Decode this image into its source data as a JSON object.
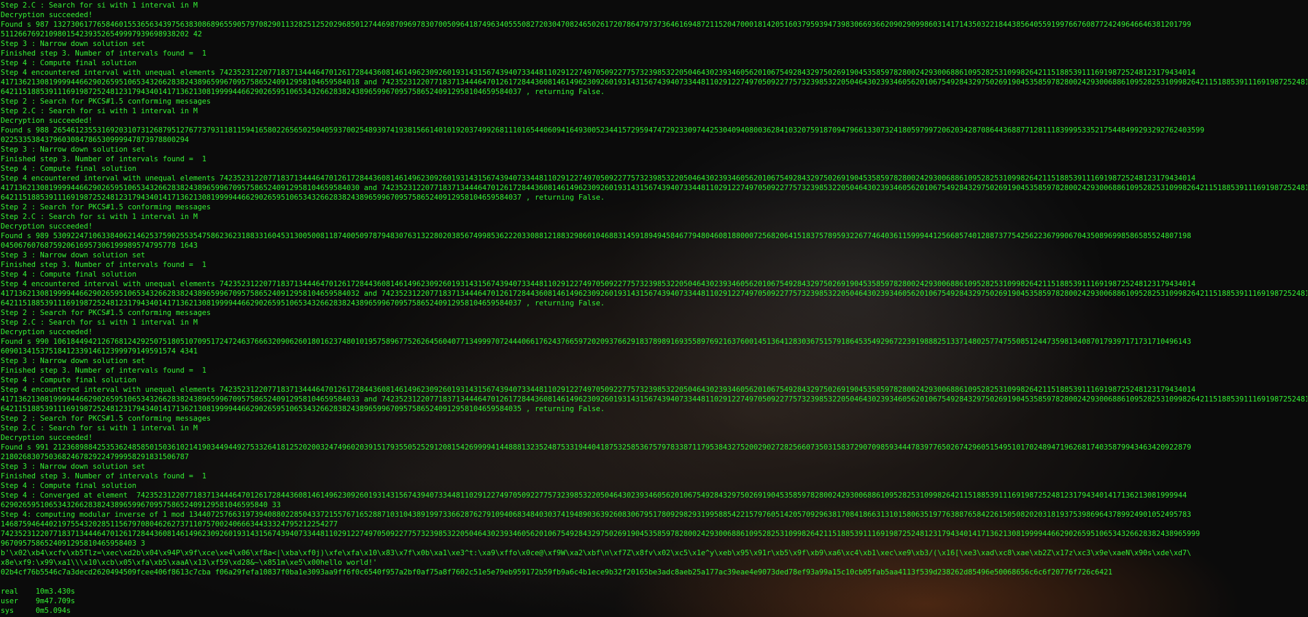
{
  "terminal": {
    "lines": [
      "Step 2.C : Search for si with 1 interval in M",
      "Decryption succeeded!",
      "Found s 987 13273061776584601553656343975638308689655905797082901132825125202968501274469870969783070050964187496340555082720304708246502617207864797373646169487211520470001814205160379593947398306693662090290998603141714350322184438564055919976676087724249646646381201799",
      "5112667692109801542393526549997939698938202 42",
      "Step 3 : Narrow down solution set",
      "Finished step 3. Number of intervals found =  1",
      "Step 4 : Compute final solution",
      "Step 4 encountered interval with unequal elements 7423523122077183713444647012617284436081461496230926019314315674394073344811029122749705092277573239853220504643023934605620106754928432975026919045358597828002429300688610952825310998264211518853911169198725248123179434014",
      "4171362130819999446629026595106534326628382438965996709575865240912958104659584018 and 7423523122077183713444647012617284436081461496230926019314315674394073344811029122749705092277573239853220504643023934605620106754928432975026919045358597828002429300688610952825310998264211518853911169198725248123179",
      "64211518853911169198725248123179434014171362130819999446629026595106534326628382438965996709575865240912958104659584037 , returning False.",
      "Step 2 : Search for PKCS#1.5 conforming messages",
      "Step 2.C : Search for si with 1 interval in M",
      "Decryption succeeded!",
      "Found s 988 26546123553169203107312687951276773793118115941658022656502504059370025489397419381566140101920374992681110165440609416493005234415729594747292330974425304094080036284103207591870947966133073241805979972062034287086443688771281118399953352175448499293292762403599",
      "0225335384379603084786530999947873978800294",
      "Step 3 : Narrow down solution set",
      "Finished step 3. Number of intervals found =  1",
      "Step 4 : Compute final solution",
      "Step 4 encountered interval with unequal elements 7423523122077183713444647012617284436081461496230926019314315674394073344811029122749705092277573239853220504643023934605620106754928432975026919045358597828002429300688610952825310998264211518853911169198725248123179434014",
      "4171362130819999446629026595106534326628382438965996709575865240912958104659584030 and 7423523122077183713444647012617284436081461496230926019314315674394073344811029122749705092277573239853220504643023934605620106754928432975026919045358597828002429300688610952825310998264211518853911169198725248123179",
      "64211518853911169198725248123179434014171362130819999446629026595106534326628382438965996709575865240912958104659584037 , returning False.",
      "Step 2 : Search for PKCS#1.5 conforming messages",
      "Step 2.C : Search for si with 1 interval in M",
      "Decryption succeeded!",
      "Found s 989 53092247106338406214625375902553547586236231883316045313005008118740050978794830763132280203856749985362220330881218832986010468831459189494584677948046081880007256820641518375789593226774640361159994412566857401288737754256223679906704350896998586585524807198",
      "0450676076875920616957306199989574795778 1643",
      "Step 3 : Narrow down solution set",
      "Finished step 3. Number of intervals found =  1",
      "Step 4 : Compute final solution",
      "Step 4 encountered interval with unequal elements 7423523122077183713444647012617284436081461496230926019314315674394073344811029122749705092277573239853220504643023934605620106754928432975026919045358597828002429300688610952825310998264211518853911169198725248123179434014",
      "4171362130819999446629026595106534326628382438965996709575865240912958104659584032 and 7423523122077183713444647012617284436081461496230926019314315674394073344811029122749705092277573239853220504643023934605620106754928432975026919045358597828002429300688610952825310998264211518853911169198725248123179",
      "64211518853911169198725248123179434014171362130819999446629026595106534326628382438965996709575865240912958104659584037 , returning False.",
      "Step 2 : Search for PKCS#1.5 conforming messages",
      "Step 2.C : Search for si with 1 interval in M",
      "Decryption succeeded!",
      "Found s 990 10618449421267681242925075180510709517247246376663209062601801623748010195758967752626456040771349997072444066176243766597202093766291837898916935589769216376001451364128303675157918645354929672239198882513371480257747550851244735981340870179397171731710496143",
      "6090134153751841233914612399979149591574 4341",
      "Step 3 : Narrow down solution set",
      "Finished step 3. Number of intervals found =  1",
      "Step 4 : Compute final solution",
      "Step 4 encountered interval with unequal elements 7423523122077183713444647012617284436081461496230926019314315674394073344811029122749705092277573239853220504643023934605620106754928432975026919045358597828002429300688610952825310998264211518853911169198725248123179434014",
      "4171362130819999446629026595106534326628382438965996709575865240912958104659584033 and 7423523122077183713444647012617284436081461496230926019314315674394073344811029122749705092277573239853220504643023934605620106754928432975026919045358597828002429300688610952825310998264211518853911169198725248123179",
      "64211518853911169198725248123179434014171362130819999446629026595106534326628382438965996709575865240912958104659584035 , returning False.",
      "Step 2 : Search for PKCS#1.5 conforming messages",
      "Step 2.C : Search for si with 1 interval in M",
      "Decryption succeeded!",
      "Found s 991 21236898842535362485850150361021419034494492753326418125202003247496020391517935505252912081542699994144888132352487533194404187532585367579783387117953843275200290272825660735031583729070985934447839776502674296051549510170248947196268174035879943463420922879",
      "2180268307503682467829224799958291831506787",
      "Step 3 : Narrow down solution set",
      "Finished step 3. Number of intervals found =  1",
      "Step 4 : Compute final solution",
      "Step 4 : Converged at element  742352312207718371344464701261728443608146149623092601931431567439407334481102912274970509227757323985322050464302393460562010675492843297502691904535859782800242930068861095282531099826421151885391116919872524812317943401417136213081999944",
      "6290265951065343266283824389659967095758652409129581046595840 33",
      "Step 4: computing modular inverse of 1 mod 1344072576631973940880228504337215576716528871031043891997336628762791094068348403037419489036392608306795178092982931995885422157976051420570929638170841866313101580635197763887658422615050820203181937539869643789924901052495783",
      "14687594644021975543202851156797080462627371107570024066634433324795212254277",
      "7423523122077183713444647012617284436081461496230926019314315674394073344811029122749705092277573239853220504643023934605620106754928432975026919045358597828002429300688610952825310998264211518853911169198725248123179434014171362130819999446629026595106534326628382438965999",
      "9670957586524091295810465958403 3",
      "b'\\x02\\xb4\\xcfv\\xb5Tlz=\\xec\\xd2b\\x04\\x94P\\x9f\\xce\\xe4\\x06\\xf8a<|\\xba\\xf0j)\\xfe\\xfa\\x10\\x83\\x7f\\x0b\\xa1\\xe3^t:\\xa9\\xffo\\x0ce@\\xf9W\\xa2\\xbf\\n\\xf7Z\\x8fv\\x02\\xc5\\x1e^y\\xeb\\x95\\x91r\\xb5\\x9f\\xb9\\xa6\\xc4\\xb1\\xec\\xe9\\xb3/(\\x16[\\xe3\\xad\\xc8\\xae\\xb2Z\\x17z\\xc3\\x9e\\xaeN\\x90s\\xde\\xd7\\",
      "x8e\\xf9:\\x99\\xa1\\\\\\x10\\xcb\\x05\\xfa\\xb5\\xaaA\\x13\\xf59\\xd28&~\\x851m\\xe5\\x00hello world!'",
      "02b4cf76b5546c7a3decd2620494509fcee406f8613c7cba f06a29fefa10837f0ba1e3093aa9ff6f0c6540f957a2bf0af75a8f7602c51e5e79eb959172b59fb9a6c4b1ece9b32f20165be3adc8aeb25a177ac39eae4e9073ded78ef93a99a15c10cb05fab5aa4113f539d238262d85496e50068656c6c6f20776f726c6421",
      "",
      "real\t10m3.430s",
      "user\t9m47.709s",
      "sys\t0m5.094s"
    ]
  },
  "colors": {
    "text": "#33e633",
    "background": "#0b0b0b"
  }
}
